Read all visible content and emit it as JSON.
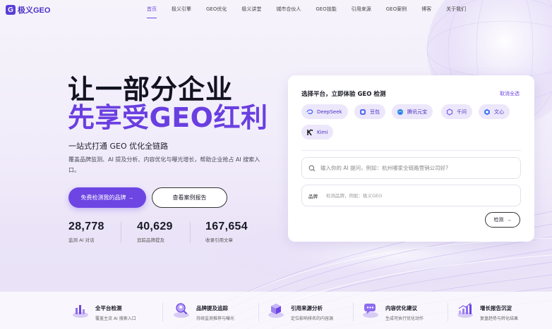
{
  "colors": {
    "accent": "#6d45e3",
    "accent_text": "#6a3fe0",
    "chip_bg": "#ece7fb",
    "dark": "#121220"
  },
  "nav": {
    "logo_mark": "G",
    "logo_text": "极义GEO",
    "links": [
      "首页",
      "极义引擎",
      "GEO优化",
      "极义讲堂",
      "城市合伙人",
      "GEO技能",
      "引用来源",
      "GEO案例",
      "博客",
      "关于我们"
    ],
    "active_index": 0
  },
  "hero": {
    "title_line1": "让一部分企业",
    "title_line2": "先享受GEO红利",
    "subtitle": "一站式打通 GEO 优化全链路",
    "description": "覆盖品牌监测、AI 提及分析、内容优化与曝光增长，帮助企业抢占 AI 搜索入口。",
    "primary_button": "免费检测我的品牌",
    "secondary_button": "查看案例报告",
    "stats": [
      {
        "value": "28,778",
        "label": "监测 AI 对话"
      },
      {
        "value": "40,629",
        "label": "追踪品牌提及"
      },
      {
        "value": "167,654",
        "label": "收录引用文章"
      }
    ]
  },
  "card": {
    "title": "选择平台，立即体验 GEO 检测",
    "deselect_all": "取消全选",
    "platforms": [
      {
        "name": "DeepSeek",
        "icon": "deepseek-icon"
      },
      {
        "name": "豆包",
        "icon": "doubao-icon"
      },
      {
        "name": "腾讯元宝",
        "icon": "yuanbao-icon"
      },
      {
        "name": "千问",
        "icon": "qianwen-icon"
      },
      {
        "name": "文心",
        "icon": "wenxin-icon"
      },
      {
        "name": "Kimi",
        "icon": "kimi-icon"
      }
    ],
    "query_placeholder": "输入你的 AI 提问，例如：杭州哪家全链路营销公司好?",
    "brand_label": "品牌",
    "brand_placeholder": "检测品牌，例如：极义GEO",
    "detect_button": "检测"
  },
  "features": [
    {
      "title": "全平台检测",
      "desc": "覆盖主流 AI 搜索入口",
      "icon": "chart-platform-icon"
    },
    {
      "title": "品牌提及追踪",
      "desc": "持续监测推荐与曝光",
      "icon": "magnifier-person-icon"
    },
    {
      "title": "引用来源分析",
      "desc": "定位影响排名的内容源",
      "icon": "cube-stack-icon"
    },
    {
      "title": "内容优化建议",
      "desc": "生成可执行优化动作",
      "icon": "chat-bubble-icon"
    },
    {
      "title": "增长报告沉淀",
      "desc": "复盘趋势与转化结果",
      "icon": "growth-bars-icon"
    }
  ]
}
